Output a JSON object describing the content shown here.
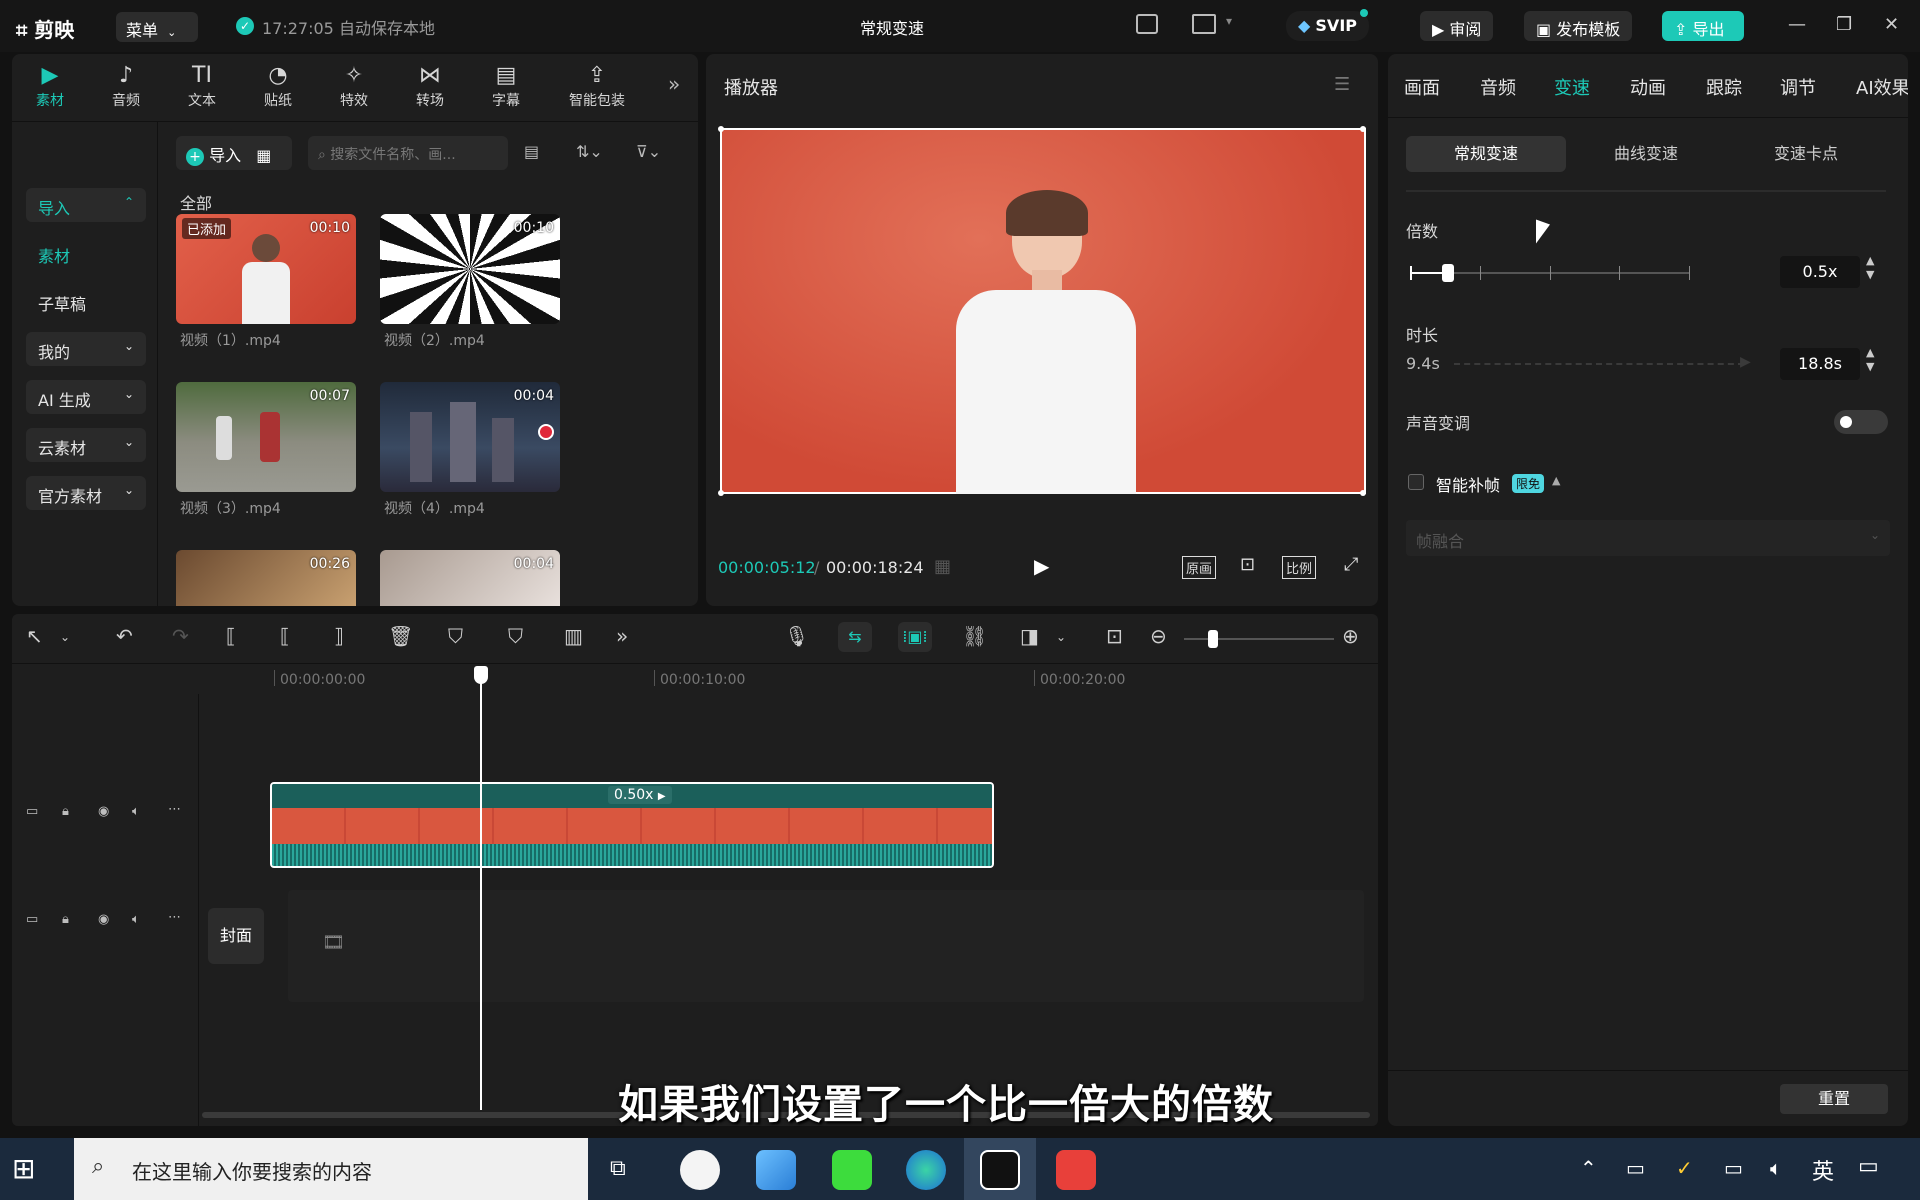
{
  "titlebar": {
    "logo": "剪映",
    "menu_label": "菜单",
    "save_status": "17:27:05 自动保存本地",
    "project_title": "常规变速",
    "svip_label": "SVIP",
    "review_label": "审阅",
    "publish_template_label": "发布模板",
    "export_label": "导出"
  },
  "media_toolbar": {
    "tabs": [
      {
        "label": "素材",
        "icon": "media-icon"
      },
      {
        "label": "音频",
        "icon": "audio-icon"
      },
      {
        "label": "文本",
        "icon": "text-icon"
      },
      {
        "label": "贴纸",
        "icon": "sticker-icon"
      },
      {
        "label": "特效",
        "icon": "effects-icon"
      },
      {
        "label": "转场",
        "icon": "transition-icon"
      },
      {
        "label": "字幕",
        "icon": "subtitle-icon"
      },
      {
        "label": "智能包装",
        "icon": "smart-pack-icon"
      }
    ]
  },
  "media_sidebar": {
    "items": [
      {
        "label": "导入"
      },
      {
        "label": "素材"
      },
      {
        "label": "子草稿"
      },
      {
        "label": "我的"
      },
      {
        "label": "AI 生成"
      },
      {
        "label": "云素材"
      },
      {
        "label": "官方素材"
      }
    ]
  },
  "media_browser": {
    "import_label": "导入",
    "search_placeholder": "搜索文件名称、画...",
    "section_title": "全部",
    "items": [
      {
        "label": "视频（1）.mp4",
        "duration": "00:10",
        "badge": "已添加"
      },
      {
        "label": "视频（2）.mp4",
        "duration": "00:10"
      },
      {
        "label": "视频（3）.mp4",
        "duration": "00:07"
      },
      {
        "label": "视频（4）.mp4",
        "duration": "00:04"
      },
      {
        "label": "",
        "duration": "00:26"
      },
      {
        "label": "",
        "duration": "00:04"
      }
    ]
  },
  "player": {
    "title": "播放器",
    "current_time": "00:00:05:12",
    "total_time": "00:00:18:24",
    "original_label": "原画",
    "ratio_label": "比例"
  },
  "props": {
    "tabs": [
      "画面",
      "音频",
      "变速",
      "动画",
      "跟踪",
      "调节",
      "AI效果"
    ],
    "speed_modes": [
      "常规变速",
      "曲线变速",
      "变速卡点"
    ],
    "multiplier_label": "倍数",
    "multiplier_value": "0.5x",
    "multiplier_level": 0.05,
    "duration_label": "时长",
    "duration_from": "9.4s",
    "duration_to": "18.8s",
    "pitch_label": "声音变调",
    "pitch_enabled": false,
    "smart_frame_label": "智能补帧",
    "smart_frame_badge": "限免",
    "frame_blend_label": "帧融合",
    "reset_label": "重置"
  },
  "timeline": {
    "ruler_ticks": [
      "00:00:00:00",
      "00:00:10:00",
      "00:00:20:00"
    ],
    "clip_speed_label": "0.50x",
    "cover_label": "封面"
  },
  "subtitle_overlay": "如果我们设置了一个比一倍大的倍数",
  "taskbar": {
    "search_placeholder": "在这里输入你要搜索的内容",
    "ime_label": "英"
  },
  "colors": {
    "accent": "#1dc9b7",
    "panel_bg": "#1e1e1e",
    "video_bg": "#d8553f"
  }
}
